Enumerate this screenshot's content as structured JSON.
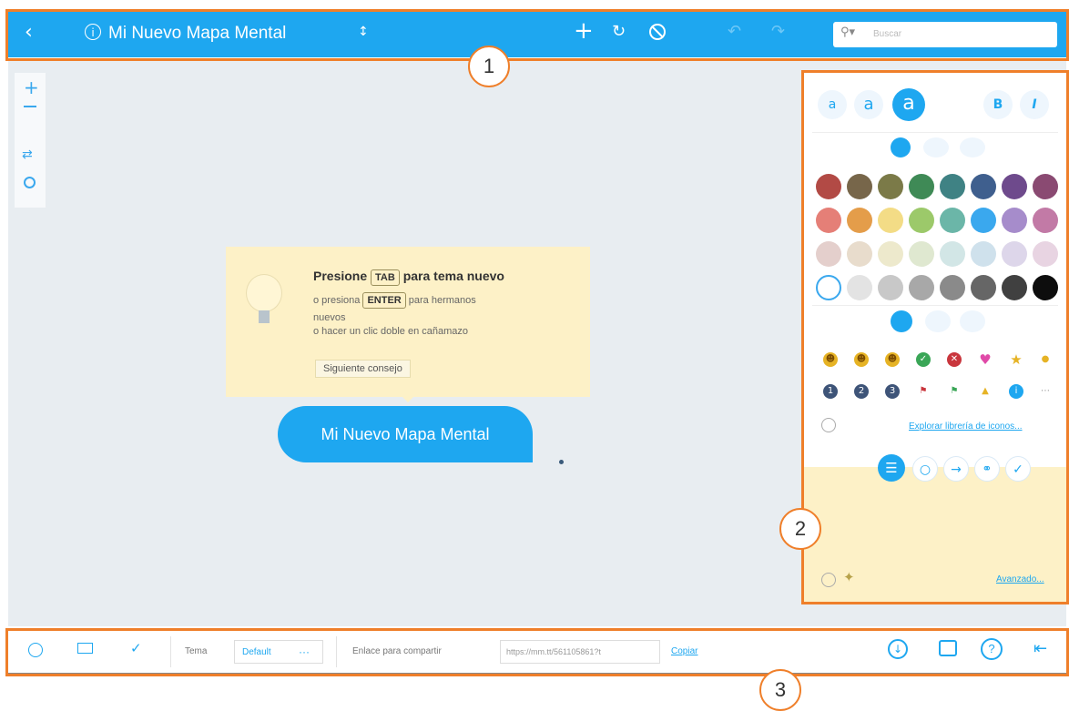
{
  "topbar": {
    "title": "Mi Nuevo Mapa Mental",
    "title_suffix": "↕",
    "search_placeholder": "Buscar",
    "bg_color": "#1ea7f0"
  },
  "left_toolbar": {
    "icons": [
      "zoom-in-icon",
      "zoom-out-icon",
      "fit-icon",
      "center-icon"
    ]
  },
  "tip": {
    "line1_prefix": "Presione",
    "key1": "TAB",
    "line1_suffix": "para tema nuevo",
    "line2_prefix": "o presiona",
    "key2": "ENTER",
    "line2_suffix": "para hermanos",
    "line3": "nuevos",
    "line4": "o hacer un clic doble en cañamazo",
    "next_button": "Siguiente consejo"
  },
  "node": {
    "label": "Mi Nuevo Mapa Mental",
    "color": "#1ea7f0"
  },
  "panel": {
    "size_labels": [
      "a",
      "a",
      "a"
    ],
    "bold": "B",
    "italic": "I",
    "swatch_colors": [
      [
        "#b24a45",
        "#77664a",
        "#7b7a48",
        "#3f8a56",
        "#3f8284",
        "#3f5f8e",
        "#6e4a8c",
        "#8a4a72"
      ],
      [
        "#e57f77",
        "#e49d4a",
        "#f3dc86",
        "#9cc96a",
        "#6bb6a8",
        "#3aa8ee",
        "#a68ccb",
        "#c27aa6"
      ],
      [
        "#e4cfcc",
        "#e8dccc",
        "#ede9cc",
        "#dfe8d0",
        "#d2e6e6",
        "#cfe1ec",
        "#ddd6ea",
        "#e8d4e2"
      ],
      [
        "#ffffff",
        "#e3e3e3",
        "#c8c8c8",
        "#a8a8a8",
        "#8a8a8a",
        "#666666",
        "#404040",
        "#0d0d0d"
      ]
    ],
    "explore_icons_link": "Explorar librería de iconos...",
    "advanced_link": "Avanzado..."
  },
  "bottombar": {
    "tema_label": "Tema",
    "tema_value": "Default",
    "tema_more": "···",
    "share_label": "Enlace para compartir",
    "share_url": "https://mm.tt/561105861?t",
    "copy_link": "Copiar"
  },
  "callouts": [
    "1",
    "2",
    "3"
  ],
  "annotation_color": "#ef7f2a"
}
